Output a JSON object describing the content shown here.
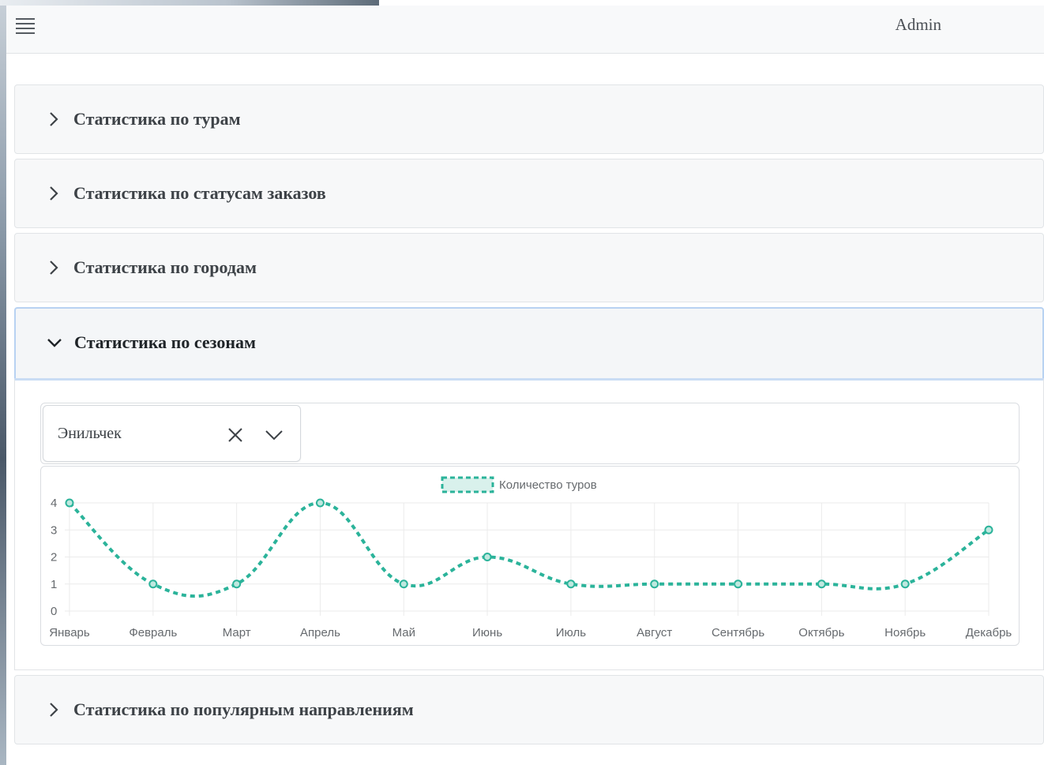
{
  "header": {
    "user": "Admin",
    "menu_icon": "hamburger-menu-icon"
  },
  "accordion": [
    {
      "title": "Статистика по турам",
      "expanded": false
    },
    {
      "title": "Статистика по статусам заказов",
      "expanded": false
    },
    {
      "title": "Статистика по городам",
      "expanded": false
    },
    {
      "title": "Статистика по сезонам",
      "expanded": true
    },
    {
      "title": "Статистика по популярным направлениям",
      "expanded": false
    }
  ],
  "season_panel": {
    "selected_city": "Энильчек"
  },
  "chart_data": {
    "type": "line",
    "categories": [
      "Январь",
      "Февраль",
      "Март",
      "Апрель",
      "Май",
      "Июнь",
      "Июль",
      "Август",
      "Сентябрь",
      "Октябрь",
      "Ноябрь",
      "Декабрь"
    ],
    "series": [
      {
        "name": "Количество туров",
        "values": [
          4,
          1,
          1,
          4,
          1,
          2,
          1,
          1,
          1,
          1,
          1,
          3
        ],
        "color": "#2bb39a",
        "style": "dashed",
        "smooth": true
      }
    ],
    "yticks": [
      0,
      1,
      2,
      3,
      4
    ],
    "ylim": [
      0,
      4
    ],
    "grid": true,
    "legend": "top"
  },
  "colors": {
    "accent": "#2bb39a",
    "focus_border": "#b8d2f2"
  }
}
